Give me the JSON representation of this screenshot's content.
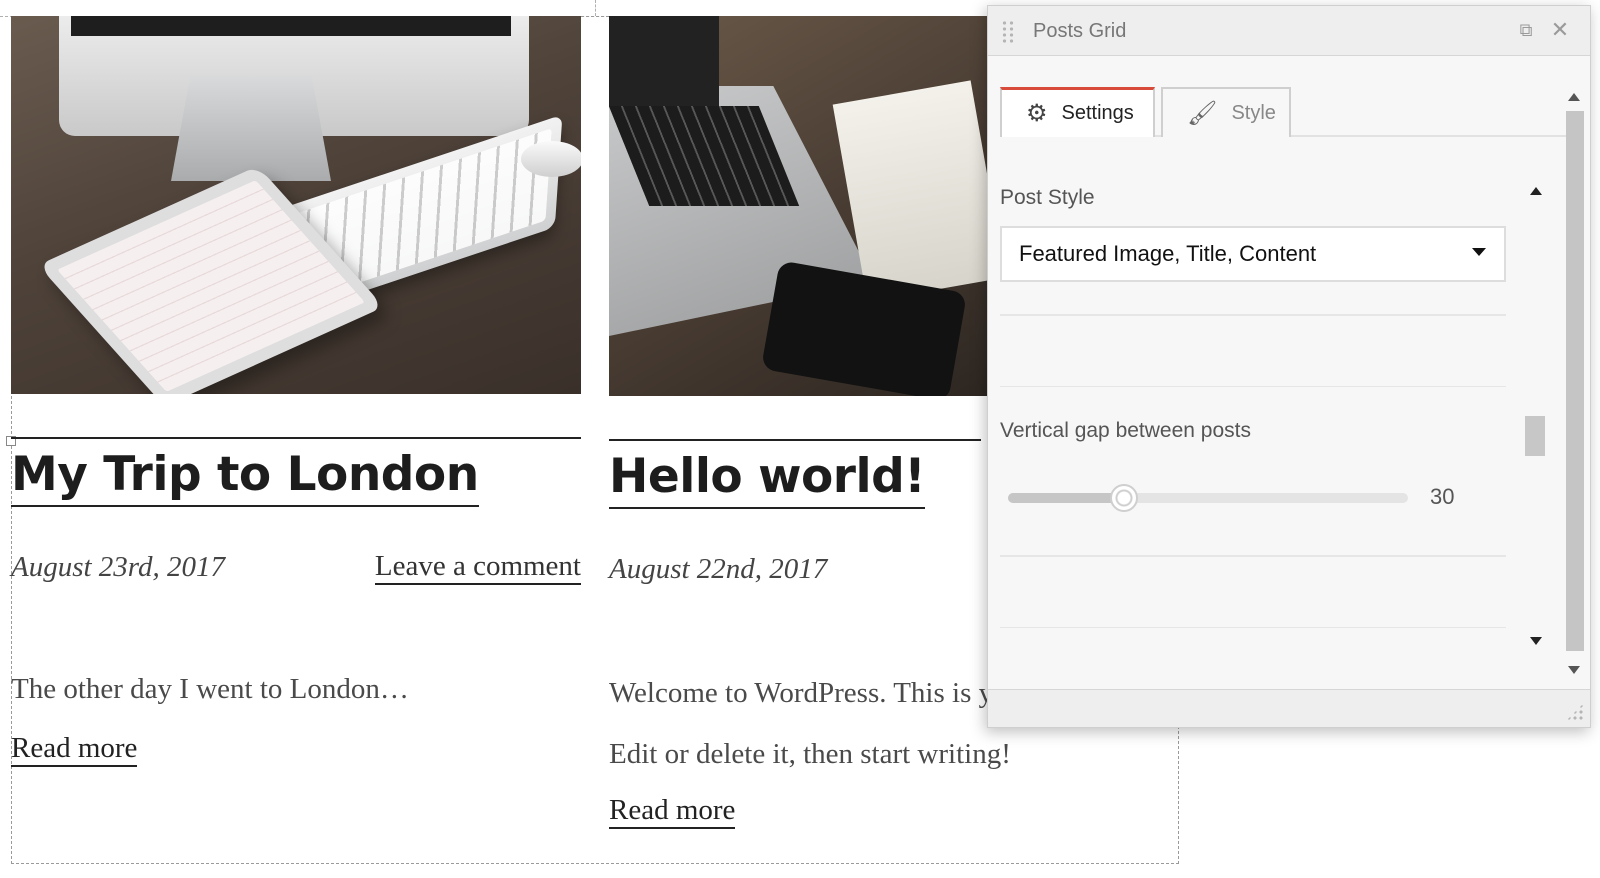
{
  "posts": [
    {
      "title": "My Trip to London",
      "date": "August 23rd, 2017",
      "comment_link": "Leave a comment",
      "excerpt": "The other day I went to London…",
      "read_more": "Read more"
    },
    {
      "title": "Hello world!",
      "date": "August 22nd, 2017",
      "excerpt": "Welcome to WordPress. This is your first post. Edit or delete it, then start writing!",
      "read_more": "Read more"
    }
  ],
  "panel": {
    "title": "Posts Grid",
    "header_icons": [
      "drag-handle-icon",
      "popout-icon",
      "close-icon"
    ],
    "tabs": [
      {
        "label": "Settings",
        "icon": "gear-icon",
        "active": true
      },
      {
        "label": "Style",
        "icon": "paintbrush-icon",
        "active": false
      }
    ],
    "post_style": {
      "label": "Post Style",
      "value": "Featured Image, Title, Content"
    },
    "vertical_gap": {
      "label": "Vertical gap between posts",
      "value": "30",
      "fraction": 0.29
    },
    "accent_color": "#d84a3a"
  }
}
